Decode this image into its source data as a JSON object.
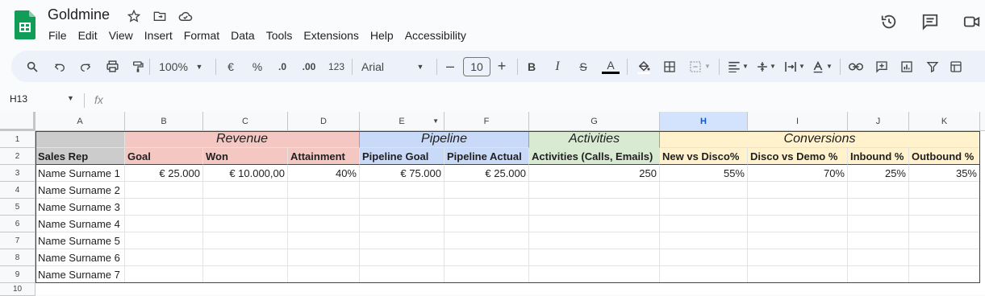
{
  "app": {
    "doc_title": "Goldmine",
    "menu": [
      "File",
      "Edit",
      "View",
      "Insert",
      "Format",
      "Data",
      "Tools",
      "Extensions",
      "Help",
      "Accessibility"
    ]
  },
  "toolbar": {
    "zoom": "100%",
    "currency": "€",
    "percent": "%",
    "dec_decrease": ".0",
    "dec_increase": ".00",
    "number_format": "123",
    "font": "Arial",
    "font_size": "10",
    "bold": "B",
    "italic": "I",
    "strike": "S",
    "text_color_letter": "A"
  },
  "formula_bar": {
    "cell_ref": "H13",
    "fx": "fx"
  },
  "grid": {
    "columns": [
      "A",
      "B",
      "C",
      "D",
      "E",
      "F",
      "G",
      "H",
      "I",
      "J",
      "K"
    ],
    "rows": [
      "1",
      "2",
      "3",
      "4",
      "5",
      "6",
      "7",
      "8",
      "9",
      "10"
    ],
    "groups": [
      {
        "label": "Revenue",
        "color": "#f4c7c3"
      },
      {
        "label": "Pipeline",
        "color": "#c9daf8"
      },
      {
        "label": "Activities",
        "color": "#d9ead3"
      },
      {
        "label": "Conversions",
        "color": "#fff2cc"
      }
    ],
    "headers": [
      "Sales Rep",
      "Goal",
      "Won",
      "Attainment",
      "Pipeline Goal",
      "Pipeline Actual",
      "Activities (Calls, Emails)",
      "New vs Disco%",
      "Disco vs Demo %",
      "Inbound %",
      "Outbound %"
    ],
    "row3": [
      "Name Surname 1",
      "€ 25.000",
      "€ 10.000,00",
      "40%",
      "€ 75.000",
      "€ 25.000",
      "250",
      "55%",
      "70%",
      "25%",
      "35%"
    ],
    "names": [
      "Name Surname 2",
      "Name Surname 3",
      "Name Surname 4",
      "Name Surname 5",
      "Name Surname 6",
      "Name Surname 7"
    ]
  },
  "colors": {
    "header_gray": "#cccccc",
    "selected_column": "#d3e3fd"
  }
}
